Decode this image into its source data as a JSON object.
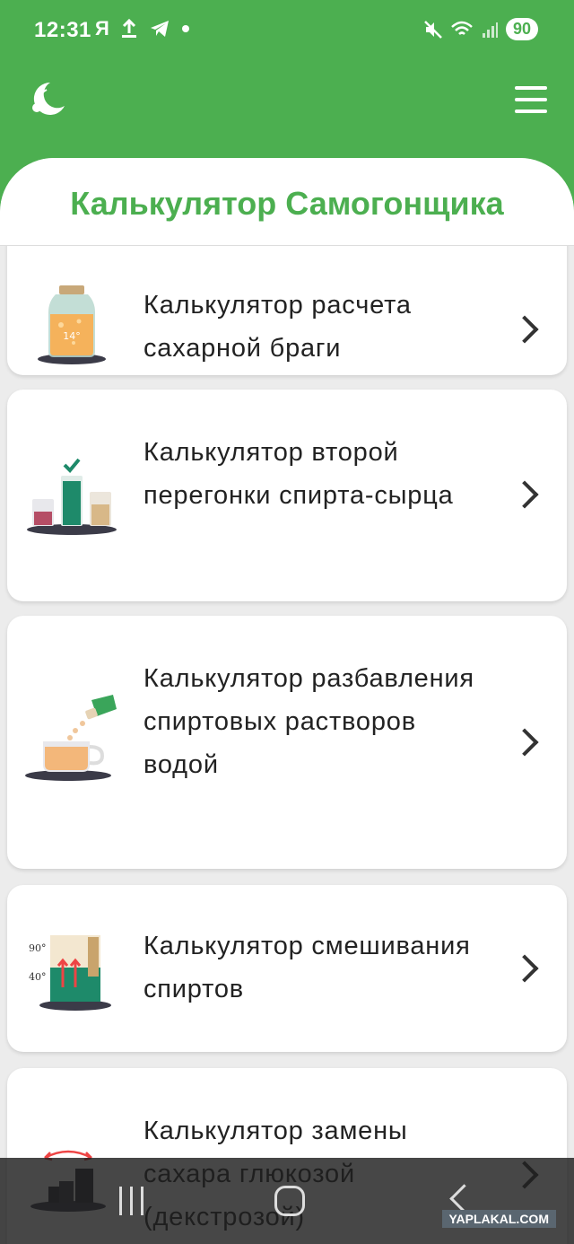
{
  "status_bar": {
    "time": "12:31",
    "left_icons": [
      "yandex-icon",
      "upload-icon",
      "telegram-icon",
      "dot-icon"
    ],
    "yandex_glyph": "Я",
    "battery": "90"
  },
  "app_bar": {
    "logo_icon": "moon-cherry-logo",
    "menu_icon": "hamburger-icon"
  },
  "header": {
    "title": "Калькулятор Самогонщика"
  },
  "calculators": [
    {
      "label": "Калькулятор расчета сахарной браги",
      "icon": "jar-icon",
      "jar_text": "14°"
    },
    {
      "label": "Калькулятор второй перегонки спирта-сырца",
      "icon": "beakers-icon"
    },
    {
      "label": "Калькулятор разбавления спиртовых растворов водой",
      "icon": "pouring-cup-icon"
    },
    {
      "label": "Калькулятор смешивания спиртов",
      "icon": "mixing-icon",
      "tick_top": "90°",
      "tick_bottom": "40°"
    },
    {
      "label": "Калькулятор замены сахара глюкозой (декстрозой)",
      "icon": "scale-icon"
    }
  ],
  "nav_bar": {
    "buttons": [
      "recent-apps",
      "home",
      "back"
    ]
  },
  "watermark": "YAPLAKAL.COM",
  "colors": {
    "accent": "#4caf50",
    "background": "#ececec",
    "card": "#ffffff"
  }
}
